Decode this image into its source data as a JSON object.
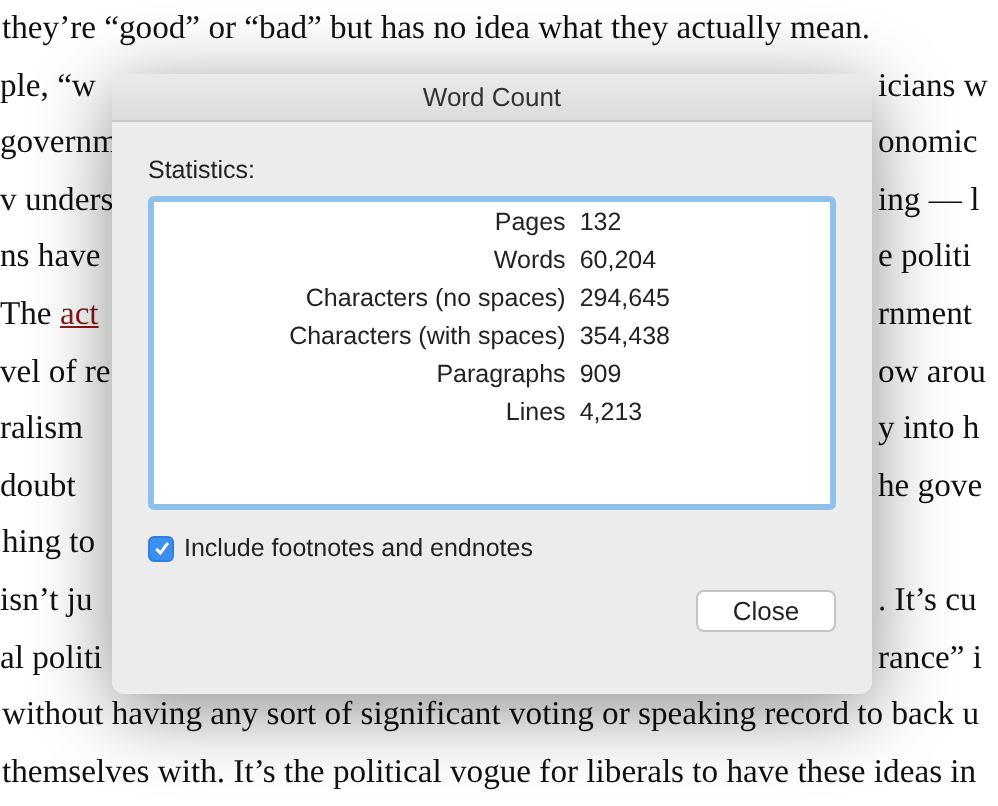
{
  "document": {
    "lines": [
      {
        "left": "they’re “good” or “bad” but has no idea what they actually mean."
      },
      {
        "left": "ple, “w",
        "right": "icians w"
      },
      {
        "left": "governm",
        "right": "onomic"
      },
      {
        "left": "v unders",
        "right": "ing — l"
      },
      {
        "left": "ns have",
        "right": "e politi"
      },
      {
        "left": "The ",
        "link": "act",
        "right": "rnment"
      },
      {
        "left": "vel of re",
        "right": "ow arou"
      },
      {
        "left": "ralism",
        "right": "y into h"
      },
      {
        "left": "doubt",
        "right": "he gove"
      },
      {
        "left": "hing to"
      },
      {
        "left": "isn’t ju",
        "right": ". It’s cu"
      },
      {
        "left": "al politi",
        "right": "rance” i"
      },
      {
        "left": "without having any sort of significant voting or speaking record to back u"
      },
      {
        "left": "themselves with. It’s the political vogue for liberals to have these ideas in"
      }
    ]
  },
  "dialog": {
    "title": "Word Count",
    "section_label": "Statistics:",
    "stats": [
      {
        "label": "Pages",
        "value": "132"
      },
      {
        "label": "Words",
        "value": "60,204"
      },
      {
        "label": "Characters (no spaces)",
        "value": "294,645"
      },
      {
        "label": "Characters (with spaces)",
        "value": "354,438"
      },
      {
        "label": "Paragraphs",
        "value": "909"
      },
      {
        "label": "Lines",
        "value": "4,213"
      }
    ],
    "checkbox": {
      "label": "Include footnotes and endnotes",
      "checked": true
    },
    "button": "Close"
  }
}
